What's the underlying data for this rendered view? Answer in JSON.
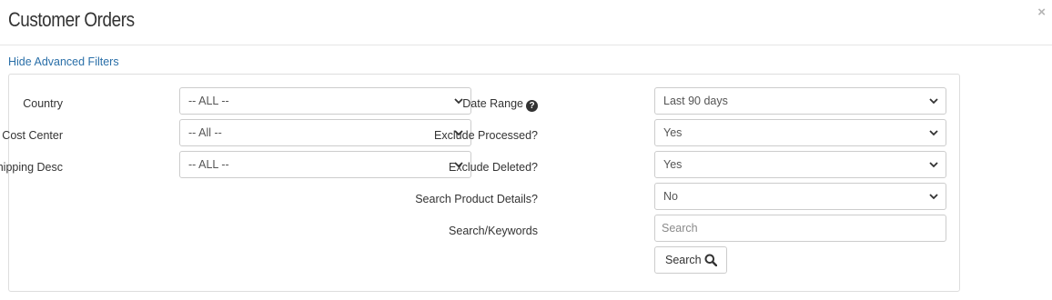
{
  "header": {
    "title": "Customer Orders",
    "close_symbol": "×"
  },
  "filters_toggle": {
    "label": "Hide Advanced Filters"
  },
  "left_filters": {
    "country": {
      "label": "Country",
      "value": "-- ALL --"
    },
    "cost_center": {
      "label": "Cost Center",
      "value": "-- All --"
    },
    "shipping_desc": {
      "label": "Shipping Desc",
      "value": "-- ALL --"
    }
  },
  "right_filters": {
    "date_range": {
      "label": "Date Range",
      "value": "Last 90 days",
      "help_icon": "question-circle-icon"
    },
    "exclude_processed": {
      "label": "Exclude Processed?",
      "value": "Yes"
    },
    "exclude_deleted": {
      "label": "Exclude Deleted?",
      "value": "Yes"
    },
    "search_product_details": {
      "label": "Search Product Details?",
      "value": "No"
    },
    "keywords": {
      "label": "Search/Keywords",
      "placeholder": "Search",
      "value": ""
    }
  },
  "search_button": {
    "label": "Search",
    "icon": "magnifier-icon"
  },
  "colors": {
    "link": "#2a6fa8",
    "border": "#cccccc",
    "text": "#333333"
  }
}
